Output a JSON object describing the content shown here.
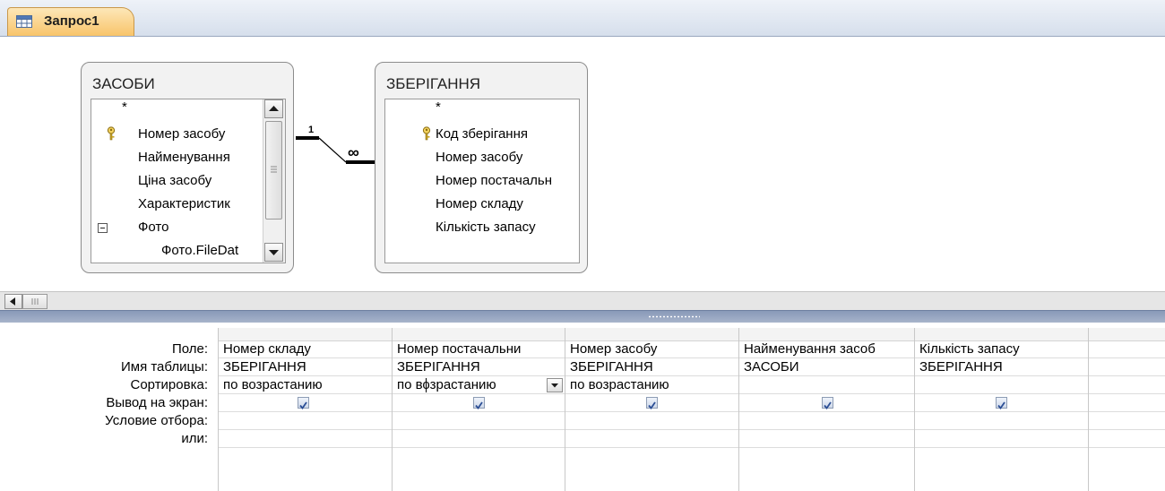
{
  "tab": {
    "title": "Запрос1",
    "icon": "query-design-icon"
  },
  "tables": [
    {
      "name": "ЗАСОБИ",
      "fields": [
        {
          "label": "*",
          "key": false
        },
        {
          "label": "Номер засобу",
          "key": true
        },
        {
          "label": "Найменування",
          "key": false
        },
        {
          "label": "Ціна засобу",
          "key": false
        },
        {
          "label": "Характеристик",
          "key": false
        },
        {
          "label": "Фото",
          "key": false,
          "expander": true
        },
        {
          "label": "Фото.FileDat",
          "key": false,
          "child": true
        }
      ]
    },
    {
      "name": "ЗБЕРІГАННЯ",
      "fields": [
        {
          "label": "*",
          "key": false
        },
        {
          "label": "Код зберігання",
          "key": true
        },
        {
          "label": "Номер засобу",
          "key": false
        },
        {
          "label": "Номер постачальн",
          "key": false
        },
        {
          "label": "Номер складу",
          "key": false
        },
        {
          "label": "Кількість запасу",
          "key": false
        }
      ]
    }
  ],
  "relationship": {
    "one_label": "1",
    "many_label": "∞"
  },
  "grid": {
    "row_labels": {
      "field": "Поле:",
      "table": "Имя таблицы:",
      "sort": "Сортировка:",
      "show": "Вывод на экран:",
      "criteria": "Условие отбора:",
      "or": "или:"
    },
    "columns": [
      {
        "field": "Номер складу",
        "table": "ЗБЕРІГАННЯ",
        "sort": "по возрастанию",
        "show": true
      },
      {
        "field": "Номер постачальни",
        "table": "ЗБЕРІГАННЯ",
        "sort": "по возрастанию",
        "show": true,
        "active_dropdown": true
      },
      {
        "field": "Номер засобу",
        "table": "ЗБЕРІГАННЯ",
        "sort": "по возрастанию",
        "show": true
      },
      {
        "field": "Найменування засоб",
        "table": "ЗАСОБИ",
        "sort": "",
        "show": true
      },
      {
        "field": "Кількість запасу",
        "table": "ЗБЕРІГАННЯ",
        "sort": "",
        "show": true
      },
      {
        "field": "",
        "table": "",
        "sort": "",
        "show": false
      }
    ]
  },
  "colors": {
    "tab_bg": "#f8c46a",
    "tab_strip": "#d6dfec",
    "splitter": "#8899b8",
    "table_box_bg": "#f2f2f2"
  }
}
